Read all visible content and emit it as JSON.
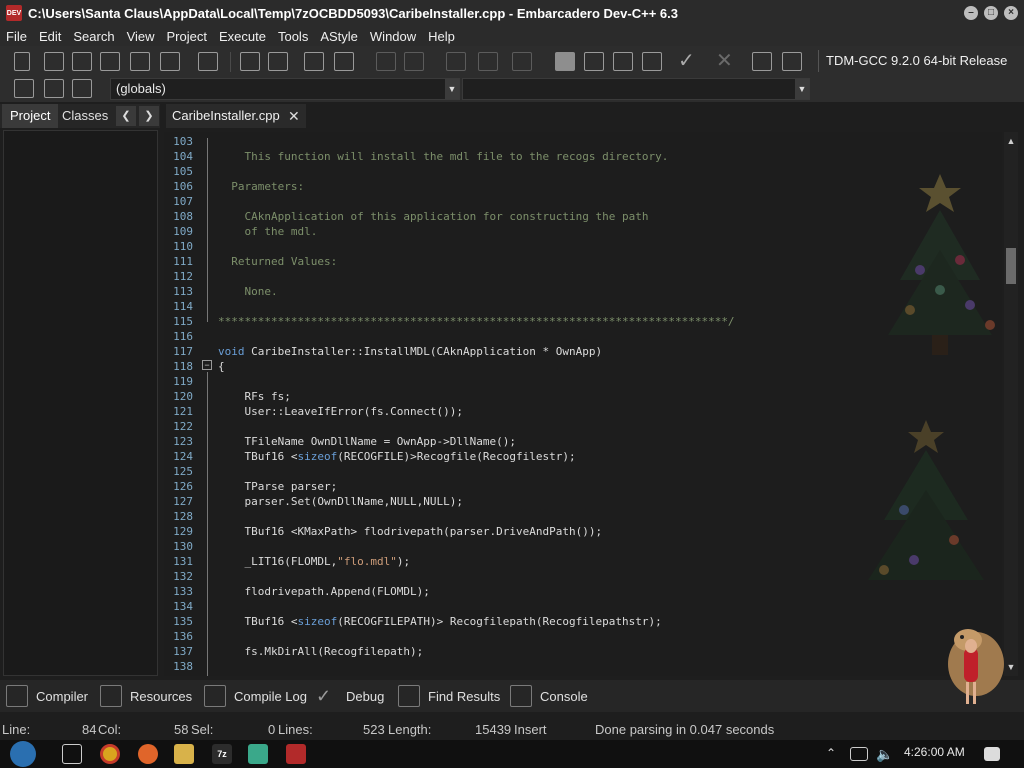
{
  "window": {
    "title": "C:\\Users\\Santa Claus\\AppData\\Local\\Temp\\7zOCBDD5093\\CaribeInstaller.cpp - Embarcadero Dev-C++ 6.3",
    "app_icon_text": "DEV"
  },
  "menu": [
    "File",
    "Edit",
    "Search",
    "View",
    "Project",
    "Execute",
    "Tools",
    "AStyle",
    "Window",
    "Help"
  ],
  "toolbar": {
    "compiler": "TDM-GCC 9.2.0 64-bit Release"
  },
  "scope_combo": {
    "value": "(globals)",
    "second_value": ""
  },
  "left_panel": {
    "tabs": [
      "Project",
      "Classes"
    ],
    "active": "Project"
  },
  "editor": {
    "tab_label": "CaribeInstaller.cpp",
    "lines": [
      {
        "n": "103",
        "html": ""
      },
      {
        "n": "104",
        "html": "<span class='c-comment'>    This function will install the mdl file to the recogs directory.</span>"
      },
      {
        "n": "105",
        "html": ""
      },
      {
        "n": "106",
        "html": "<span class='c-comment'>  Parameters:</span>"
      },
      {
        "n": "107",
        "html": ""
      },
      {
        "n": "108",
        "html": "<span class='c-comment'>    CAknApplication of this application for constructing the path</span>"
      },
      {
        "n": "109",
        "html": "<span class='c-comment'>    of the mdl.</span>"
      },
      {
        "n": "110",
        "html": ""
      },
      {
        "n": "111",
        "html": "<span class='c-comment'>  Returned Values:</span>"
      },
      {
        "n": "112",
        "html": ""
      },
      {
        "n": "113",
        "html": "<span class='c-comment'>    None.</span>"
      },
      {
        "n": "114",
        "html": ""
      },
      {
        "n": "115",
        "html": "<span class='c-comment'>*****************************************************************************/</span>"
      },
      {
        "n": "116",
        "html": ""
      },
      {
        "n": "117",
        "html": "<span class='c-kw'>void</span> CaribeInstaller::InstallMDL(CAknApplication * OwnApp)"
      },
      {
        "n": "118",
        "html": "{"
      },
      {
        "n": "119",
        "html": ""
      },
      {
        "n": "120",
        "html": "    RFs fs;"
      },
      {
        "n": "121",
        "html": "    User::LeaveIfError(fs.Connect());"
      },
      {
        "n": "122",
        "html": ""
      },
      {
        "n": "123",
        "html": "    TFileName OwnDllName = OwnApp-&gt;DllName();"
      },
      {
        "n": "124",
        "html": "    TBuf16 &lt;<span class='c-kw'>sizeof</span>(RECOGFILE)&gt;Recogfile(Recogfilestr);"
      },
      {
        "n": "125",
        "html": ""
      },
      {
        "n": "126",
        "html": "    TParse parser;"
      },
      {
        "n": "127",
        "html": "    parser.Set(OwnDllName,NULL,NULL);"
      },
      {
        "n": "128",
        "html": ""
      },
      {
        "n": "129",
        "html": "    TBuf16 &lt;KMaxPath&gt; flodrivepath(parser.DriveAndPath());"
      },
      {
        "n": "130",
        "html": ""
      },
      {
        "n": "131",
        "html": "    _LIT16(FLOMDL,<span class='c-str'>\"flo.mdl\"</span>);"
      },
      {
        "n": "132",
        "html": ""
      },
      {
        "n": "133",
        "html": "    flodrivepath.Append(FLOMDL);"
      },
      {
        "n": "134",
        "html": ""
      },
      {
        "n": "135",
        "html": "    TBuf16 &lt;<span class='c-kw'>sizeof</span>(RECOGFILEPATH)&gt; Recogfilepath(Recogfilepathstr);"
      },
      {
        "n": "136",
        "html": ""
      },
      {
        "n": "137",
        "html": "    fs.MkDirAll(Recogfilepath);"
      },
      {
        "n": "138",
        "html": ""
      }
    ]
  },
  "bottom_tabs": [
    "Compiler",
    "Resources",
    "Compile Log",
    "Debug",
    "Find Results",
    "Console"
  ],
  "status": {
    "line_label": "Line:",
    "line_value": "84",
    "col_label": "Col:",
    "col_value": "58",
    "sel_label": "Sel:",
    "sel_value": "0",
    "lines_label": "Lines:",
    "lines_value": "523",
    "length_label": "Length:",
    "length_value": "15439",
    "mode": "Insert",
    "message": "Done parsing in 0.047 seconds"
  },
  "taskbar": {
    "clock": "4:26:00 AM",
    "zip_label": "7z"
  },
  "colors": {
    "comment": "#7c8f6a",
    "keyword": "#6a9fd8",
    "string": "#ce9d7a",
    "line_number": "#7fa9c6"
  }
}
